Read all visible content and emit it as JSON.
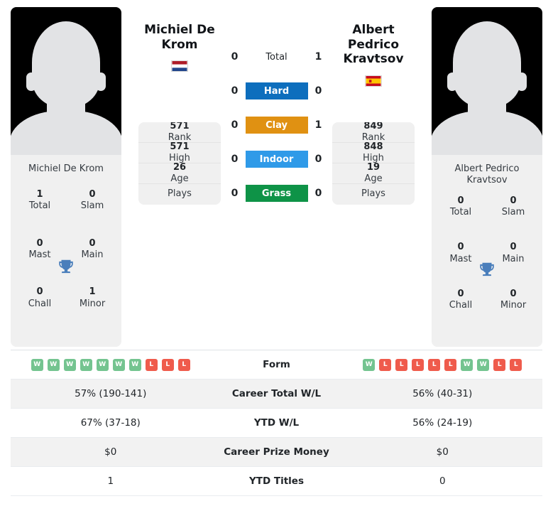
{
  "players": {
    "left": {
      "name": "Michiel De Krom",
      "name_header": "Michiel De\nKrom",
      "name_line1": "Michiel De",
      "name_line2": "Krom",
      "country": "Netherlands",
      "flag_icon": "flag-netherlands",
      "titles": {
        "total_value": "1",
        "total_label": "Total",
        "slam_value": "0",
        "slam_label": "Slam",
        "mast_value": "0",
        "mast_label": "Mast",
        "main_value": "0",
        "main_label": "Main",
        "chall_value": "0",
        "chall_label": "Chall",
        "minor_value": "1",
        "minor_label": "Minor"
      },
      "stats": {
        "rank_value": "571",
        "rank_label": "Rank",
        "high_value": "571",
        "high_label": "High",
        "age_value": "26",
        "age_label": "Age",
        "plays_value": "",
        "plays_label": "Plays"
      }
    },
    "right": {
      "name": "Albert Pedrico Kravtsov",
      "name_line1": "Albert Pedrico",
      "name_line2": "Kravtsov",
      "card_name_line1": "Albert Pedrico",
      "card_name_line2": "Kravtsov",
      "country": "Spain",
      "flag_icon": "flag-spain",
      "titles": {
        "total_value": "0",
        "total_label": "Total",
        "slam_value": "0",
        "slam_label": "Slam",
        "mast_value": "0",
        "mast_label": "Mast",
        "main_value": "0",
        "main_label": "Main",
        "chall_value": "0",
        "chall_label": "Chall",
        "minor_value": "0",
        "minor_label": "Minor"
      },
      "stats": {
        "rank_value": "849",
        "rank_label": "Rank",
        "high_value": "848",
        "high_label": "High",
        "age_value": "19",
        "age_label": "Age",
        "plays_value": "",
        "plays_label": "Plays"
      }
    }
  },
  "head_to_head": {
    "rows": [
      {
        "label": "Total",
        "left": "0",
        "right": "1",
        "color": "",
        "style": "plain"
      },
      {
        "label": "Hard",
        "left": "0",
        "right": "0",
        "color": "#0d6ebd",
        "style": "bar"
      },
      {
        "label": "Clay",
        "left": "0",
        "right": "1",
        "color": "#e09112",
        "style": "bar"
      },
      {
        "label": "Indoor",
        "left": "0",
        "right": "0",
        "color": "#2f9ae8",
        "style": "bar"
      },
      {
        "label": "Grass",
        "left": "0",
        "right": "0",
        "color": "#0e9347",
        "style": "bar"
      }
    ]
  },
  "comparison": {
    "rows": [
      {
        "label": "Form",
        "type": "form",
        "left_form": [
          "W",
          "W",
          "W",
          "W",
          "W",
          "W",
          "W",
          "L",
          "L",
          "L"
        ],
        "right_form": [
          "W",
          "L",
          "L",
          "L",
          "L",
          "L",
          "W",
          "W",
          "L",
          "L"
        ],
        "left": "",
        "right": ""
      },
      {
        "label": "Career Total W/L",
        "type": "text",
        "left": "57% (190-141)",
        "right": "56% (40-31)"
      },
      {
        "label": "YTD W/L",
        "type": "text",
        "left": "67% (37-18)",
        "right": "56% (24-19)"
      },
      {
        "label": "Career Prize Money",
        "type": "text",
        "left": "$0",
        "right": "$0"
      },
      {
        "label": "YTD Titles",
        "type": "text",
        "left": "1",
        "right": "0"
      }
    ]
  },
  "colors": {
    "hard": "#0d6ebd",
    "clay": "#e09112",
    "indoor": "#2f9ae8",
    "grass": "#0e9347",
    "win_badge": "#74c490",
    "loss_badge": "#ef5b4c",
    "panel": "#f0f0f0",
    "trophy": "#4a7ebb"
  }
}
